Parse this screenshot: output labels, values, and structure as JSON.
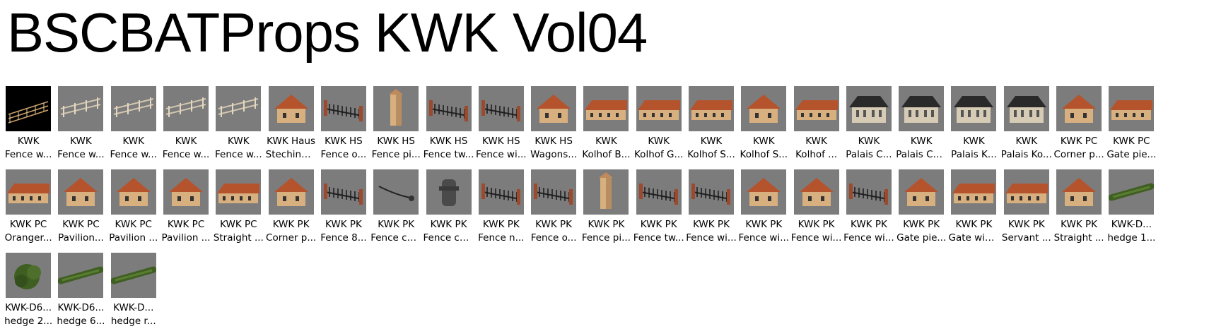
{
  "title": "BSCBATProps KWK Vol04",
  "items": [
    {
      "line1": "KWK",
      "line2": "Fence w...",
      "icon": "lit-fence-icon"
    },
    {
      "line1": "KWK",
      "line2": "Fence w...",
      "icon": "fence-icon"
    },
    {
      "line1": "KWK",
      "line2": "Fence w...",
      "icon": "fence-icon"
    },
    {
      "line1": "KWK",
      "line2": "Fence w...",
      "icon": "fence-icon"
    },
    {
      "line1": "KWK",
      "line2": "Fence w...",
      "icon": "fence-icon"
    },
    {
      "line1": "KWK Haus",
      "line2": "Stechinel...",
      "icon": "house-icon"
    },
    {
      "line1": "KWK HS",
      "line2": "Fence o...",
      "icon": "iron-fence-icon"
    },
    {
      "line1": "KWK HS",
      "line2": "Fence pi...",
      "icon": "pillar-icon"
    },
    {
      "line1": "KWK HS",
      "line2": "Fence tw...",
      "icon": "iron-fence-icon"
    },
    {
      "line1": "KWK HS",
      "line2": "Fence wi...",
      "icon": "iron-fence-icon"
    },
    {
      "line1": "KWK HS",
      "line2": "Wagons...",
      "icon": "house-icon"
    },
    {
      "line1": "KWK",
      "line2": "Kolhof B...",
      "icon": "long-house-icon"
    },
    {
      "line1": "KWK",
      "line2": "Kolhof G...",
      "icon": "long-house-icon"
    },
    {
      "line1": "KWK",
      "line2": "Kolhof S...",
      "icon": "long-house-icon"
    },
    {
      "line1": "KWK",
      "line2": "Kolhof S...",
      "icon": "house-icon"
    },
    {
      "line1": "KWK",
      "line2": "Kolhof ...",
      "icon": "long-house-icon"
    },
    {
      "line1": "KWK",
      "line2": "Palais C...",
      "icon": "palace-icon"
    },
    {
      "line1": "KWK",
      "line2": "Palais Ca...",
      "icon": "palace-icon"
    },
    {
      "line1": "KWK",
      "line2": "Palais K...",
      "icon": "palace-icon"
    },
    {
      "line1": "KWK",
      "line2": "Palais Ko...",
      "icon": "palace-icon"
    },
    {
      "line1": "KWK PC",
      "line2": "Corner p...",
      "icon": "house-icon"
    },
    {
      "line1": "KWK PC",
      "line2": "Gate pie...",
      "icon": "long-house-icon"
    },
    {
      "line1": "KWK PC",
      "line2": "Oranger...",
      "icon": "long-house-icon"
    },
    {
      "line1": "KWK PC",
      "line2": "Pavilion...",
      "icon": "house-icon"
    },
    {
      "line1": "KWK PC",
      "line2": "Pavilion ...",
      "icon": "house-icon"
    },
    {
      "line1": "KWK PC",
      "line2": "Pavilion ...",
      "icon": "house-icon"
    },
    {
      "line1": "KWK PC",
      "line2": "Straight ...",
      "icon": "long-house-icon"
    },
    {
      "line1": "KWK PK",
      "line2": "Corner p...",
      "icon": "house-icon"
    },
    {
      "line1": "KWK PK",
      "line2": "Fence 8...",
      "icon": "iron-fence-icon"
    },
    {
      "line1": "KWK PK",
      "line2": "Fence ch...",
      "icon": "chain-icon"
    },
    {
      "line1": "KWK PK",
      "line2": "Fence ch...",
      "icon": "post-icon"
    },
    {
      "line1": "KWK PK",
      "line2": "Fence n...",
      "icon": "iron-fence-icon"
    },
    {
      "line1": "KWK PK",
      "line2": "Fence o...",
      "icon": "iron-fence-icon"
    },
    {
      "line1": "KWK PK",
      "line2": "Fence pi...",
      "icon": "pillar-icon"
    },
    {
      "line1": "KWK PK",
      "line2": "Fence tw...",
      "icon": "iron-fence-icon"
    },
    {
      "line1": "KWK PK",
      "line2": "Fence wi...",
      "icon": "iron-fence-icon"
    },
    {
      "line1": "KWK PK",
      "line2": "Fence wi...",
      "icon": "house-icon"
    },
    {
      "line1": "KWK PK",
      "line2": "Fence wi...",
      "icon": "house-icon"
    },
    {
      "line1": "KWK PK",
      "line2": "Fence wi...",
      "icon": "iron-fence-icon"
    },
    {
      "line1": "KWK PK",
      "line2": "Gate pie...",
      "icon": "house-icon"
    },
    {
      "line1": "KWK PK",
      "line2": "Gate win...",
      "icon": "long-house-icon"
    },
    {
      "line1": "KWK PK",
      "line2": "Servant ...",
      "icon": "long-house-icon"
    },
    {
      "line1": "KWK PK",
      "line2": "Straight ...",
      "icon": "house-icon"
    },
    {
      "line1": "KWK-D...",
      "line2": "hedge 1...",
      "icon": "hedge-icon"
    },
    {
      "line1": "KWK-D6...",
      "line2": "hedge 2...",
      "icon": "bush-icon"
    },
    {
      "line1": "KWK-D6...",
      "line2": "hedge 6...",
      "icon": "hedge-icon"
    },
    {
      "line1": "KWK-D...",
      "line2": "hedge r...",
      "icon": "hedge-icon"
    }
  ],
  "colors": {
    "thumb_bg": "#7c7c7c",
    "roof": "#b5532d",
    "wall": "#d8b080",
    "dark_roof": "#2a2a2a",
    "hedge": "#3f5f22"
  }
}
